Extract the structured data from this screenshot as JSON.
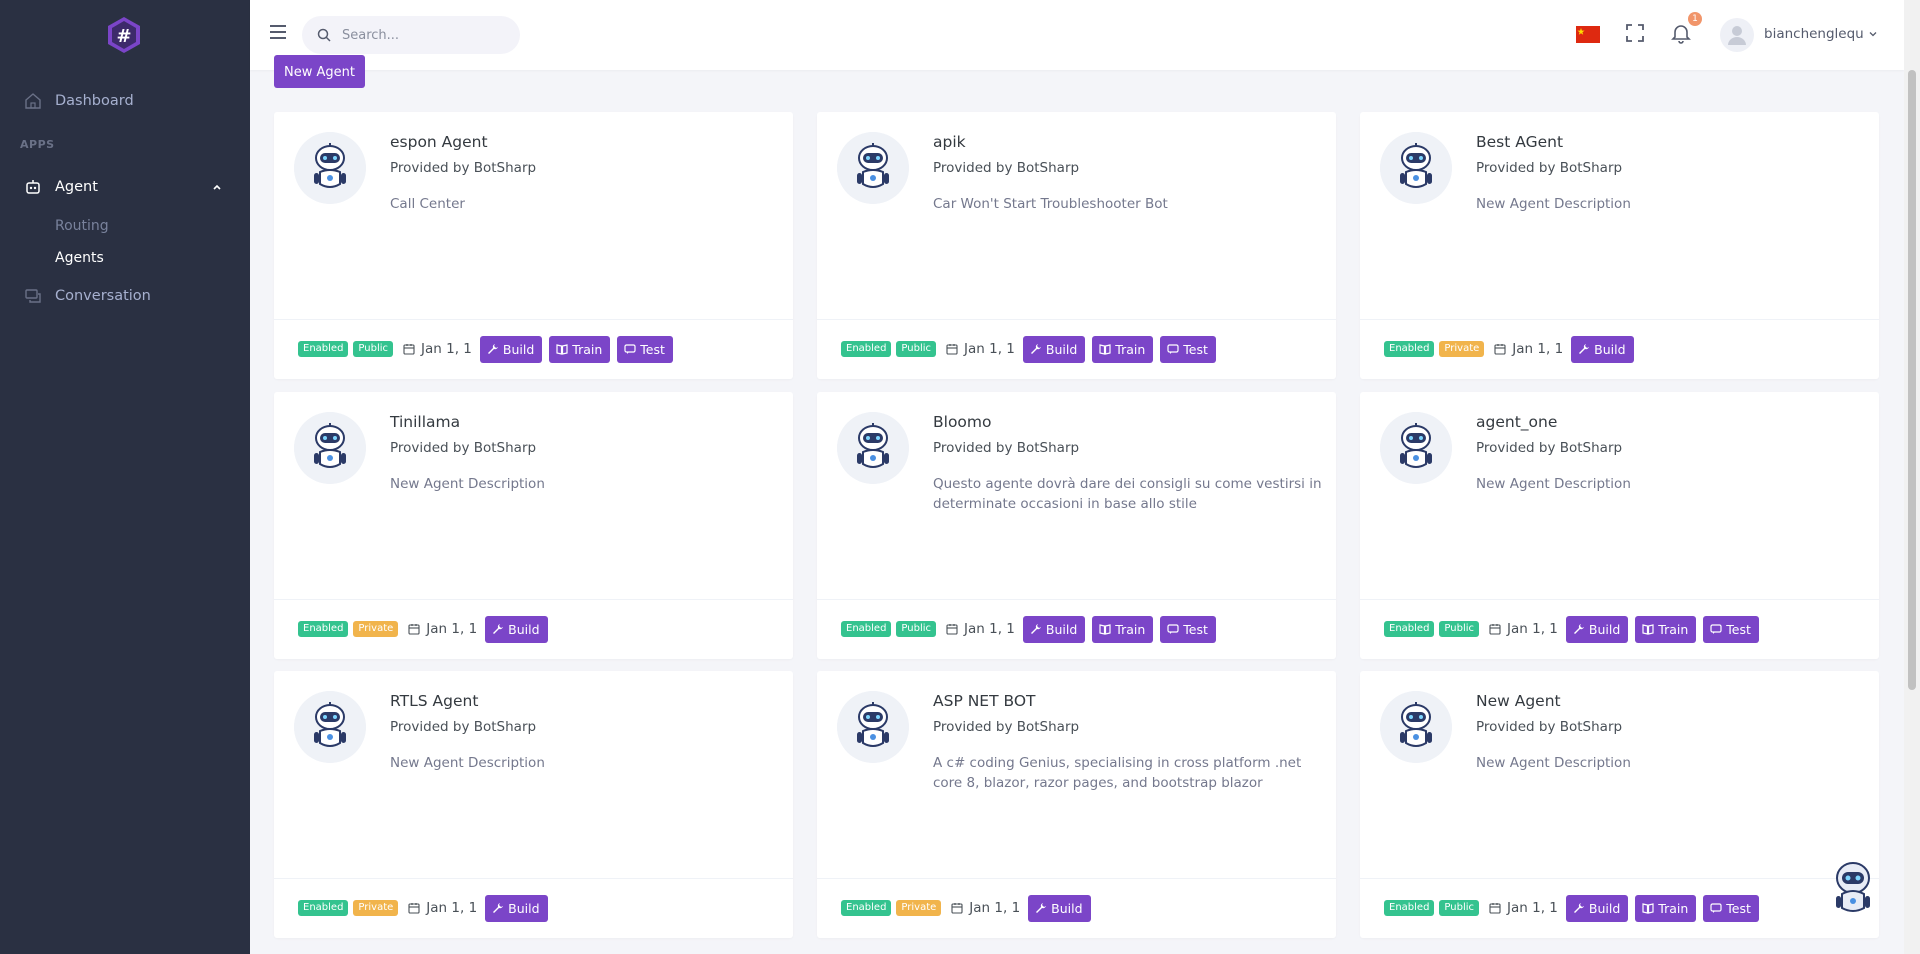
{
  "sidebar": {
    "dashboard_label": "Dashboard",
    "apps_title": "APPS",
    "agent_label": "Agent",
    "routing_label": "Routing",
    "agents_label": "Agents",
    "conversation_label": "Conversation"
  },
  "topbar": {
    "search_placeholder": "Search...",
    "notification_count": "1",
    "username": "bianchenglequ"
  },
  "new_agent_label": "New Agent",
  "common": {
    "provider": "Provided by BotSharp",
    "enabled": "Enabled",
    "date": "Jan 1, 1",
    "build": "Build",
    "train": "Train",
    "test": "Test"
  },
  "cards": [
    {
      "name": "espon Agent",
      "description": "Call Center",
      "visibility": "Public"
    },
    {
      "name": "apik",
      "description": "Car Won't Start Troubleshooter Bot",
      "visibility": "Public"
    },
    {
      "name": "Best AGent",
      "description": "New Agent Description",
      "visibility": "Private"
    },
    {
      "name": "Tinillama",
      "description": "New Agent Description",
      "visibility": "Private"
    },
    {
      "name": "Bloomo",
      "description": "Questo agente dovrà dare dei consigli su come vestirsi in determinate occasioni in base allo stile",
      "visibility": "Public"
    },
    {
      "name": "agent_one",
      "description": "New Agent Description",
      "visibility": "Public"
    },
    {
      "name": "RTLS Agent",
      "description": "New Agent Description",
      "visibility": "Private"
    },
    {
      "name": "ASP NET BOT",
      "description": "A c# coding Genius, specialising in cross platform .net core 8, blazor, razor pages, and bootstrap blazor",
      "visibility": "Private"
    },
    {
      "name": "New Agent",
      "description": "New Agent Description",
      "visibility": "Public"
    }
  ],
  "colors": {
    "sidebar_bg": "#2a3042",
    "accent": "#7b45c8",
    "success": "#34c38f",
    "warning": "#f1b44c"
  }
}
